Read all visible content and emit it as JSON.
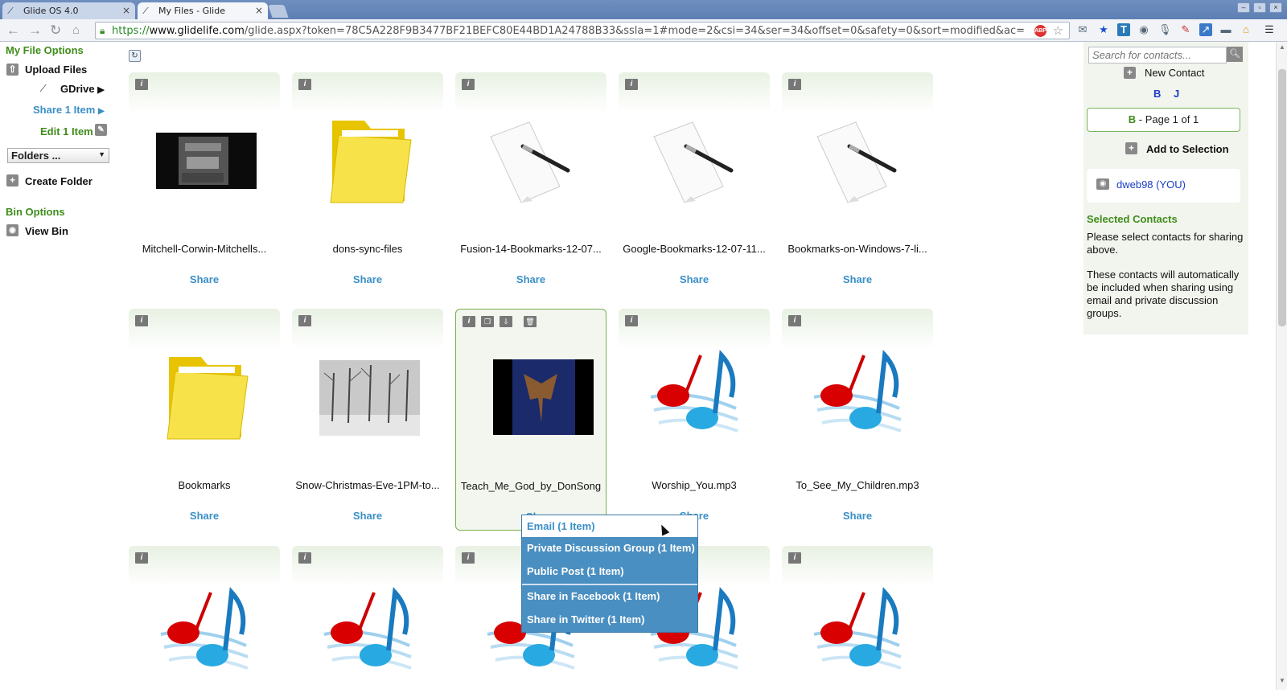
{
  "browser": {
    "tabs": [
      {
        "title": "Glide OS 4.0",
        "active": false
      },
      {
        "title": "My Files - Glide",
        "active": true
      }
    ],
    "url": {
      "scheme": "https://",
      "domain": "www.glidelife.com",
      "path": "/glide.aspx?token=78C5A228F9B3477BF21BEFC80E44BD1A24788B33&ssla=1#mode=2&csi=34&ser=34&offset=0&safety=0&sort=modified&ac="
    }
  },
  "sidebar": {
    "my_file_options": "My File Options",
    "upload_files": "Upload Files",
    "gdrive": "GDrive",
    "share_item": "Share 1 Item",
    "edit_item": "Edit 1 Item",
    "folders_select": "Folders ...",
    "create_folder": "Create Folder",
    "bin_options": "Bin Options",
    "view_bin": "View Bin"
  },
  "tiles": [
    {
      "name": "Mitchell-Corwin-Mitchells...",
      "share": "Share",
      "thumb": "video-thumb"
    },
    {
      "name": "dons-sync-files",
      "share": "Share",
      "thumb": "folder-icon"
    },
    {
      "name": "Fusion-14-Bookmarks-12-07...",
      "share": "Share",
      "thumb": "document-pen-icon"
    },
    {
      "name": "Google-Bookmarks-12-07-11...",
      "share": "Share",
      "thumb": "document-pen-icon"
    },
    {
      "name": "Bookmarks-on-Windows-7-li...",
      "share": "Share",
      "thumb": "document-pen-icon"
    },
    {
      "name": "Bookmarks",
      "share": "Share",
      "thumb": "folder-icon"
    },
    {
      "name": "Snow-Christmas-Eve-1PM-to...",
      "share": "Share",
      "thumb": "photo-thumb"
    },
    {
      "name": "Teach_Me_God_by_DonSong",
      "share": "Share",
      "thumb": "video-thumb-blue"
    },
    {
      "name": "Worship_You.mp3",
      "share": "Share",
      "thumb": "music-note-icon"
    },
    {
      "name": "To_See_My_Children.mp3",
      "share": "Share",
      "thumb": "music-note-icon"
    }
  ],
  "share_menu": [
    "Email (1 Item)",
    "Private Discussion Group (1 Item)",
    "Public Post (1 Item)",
    "Share in Facebook (1 Item)",
    "Share in Twitter (1 Item)"
  ],
  "right_panel": {
    "search_placeholder": "Search for contacts...",
    "new_contact": "New Contact",
    "letters": [
      "B",
      "J"
    ],
    "page_letter": "B",
    "page_text": " - Page 1 of 1",
    "add_to_selection": "Add to Selection",
    "contact": "dweb98 (YOU)",
    "selected_contacts": "Selected Contacts",
    "select_text": "Please select contacts for sharing above.",
    "auto_text": "These contacts will automatically be included when sharing using email and private discussion groups."
  },
  "colors": {
    "green_heading": "#3f8d1a",
    "share_blue": "#3a8fc6",
    "menu_blue": "#4a8fc1",
    "contact_blue": "#1a3ec8"
  }
}
